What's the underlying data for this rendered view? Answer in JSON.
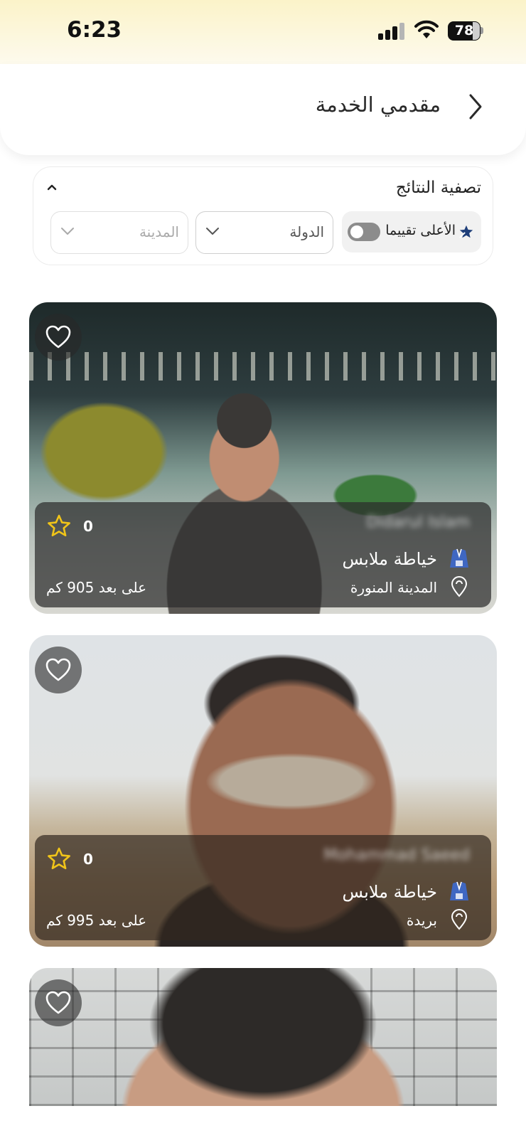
{
  "status_bar": {
    "time": "6:23",
    "battery": "78",
    "battery_level": 0.78
  },
  "header": {
    "title": "مقدمي الخدمة",
    "back_icon": "chevron-right-icon"
  },
  "filter": {
    "title": "تصفية النتائج",
    "top_rated_label": "الأعلى تقييما",
    "top_rated_enabled": false,
    "country_placeholder": "الدولة",
    "city_placeholder": "المدينة"
  },
  "providers": [
    {
      "name": "Didarul Islam",
      "rating": "0",
      "service": "خياطة ملابس",
      "city": "المدينة المنورة",
      "distance": "على بعد 905 كم"
    },
    {
      "name": "Mohammad Saeed",
      "rating": "0",
      "service": "خياطة ملابس",
      "city": "بريدة",
      "distance": "على بعد 995 كم"
    }
  ],
  "colors": {
    "accent_star": "#f0c419",
    "rated_icon": "#1f3f7a",
    "header_gradient": "#fbf3c9"
  }
}
